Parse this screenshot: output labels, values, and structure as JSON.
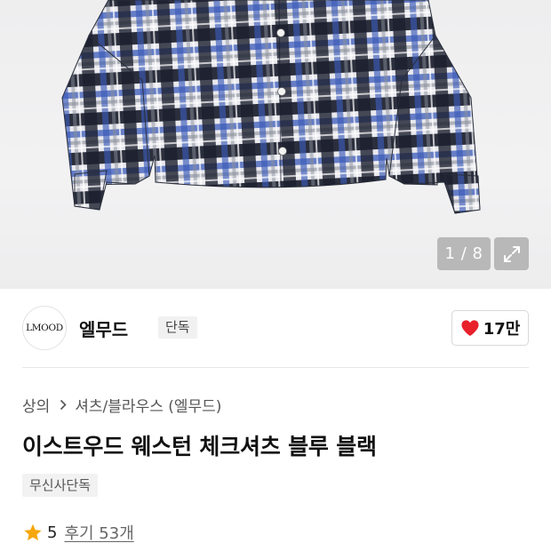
{
  "product_image": {
    "counter_current": "1",
    "counter_separator": "/",
    "counter_total": "8",
    "counter_text": "1 / 8",
    "plaid_colors": [
      "#1b1f2e",
      "#3a5ab8",
      "#ffffff",
      "#8a8f99"
    ]
  },
  "brand": {
    "logo_text": "LMOOD",
    "name": "엘무드",
    "badge": "단독",
    "like_count": "17만",
    "like_icon_color": "#e8212b"
  },
  "breadcrumb": {
    "items": [
      "상의",
      "셔츠/블라우스 (엘무드)"
    ]
  },
  "product": {
    "title": "이스트우드 웨스턴 체크셔츠 블루 블랙",
    "tag": "무신사단독"
  },
  "rating": {
    "score": "5",
    "review_link": "후기 53개",
    "star_color": "#f6a609"
  }
}
